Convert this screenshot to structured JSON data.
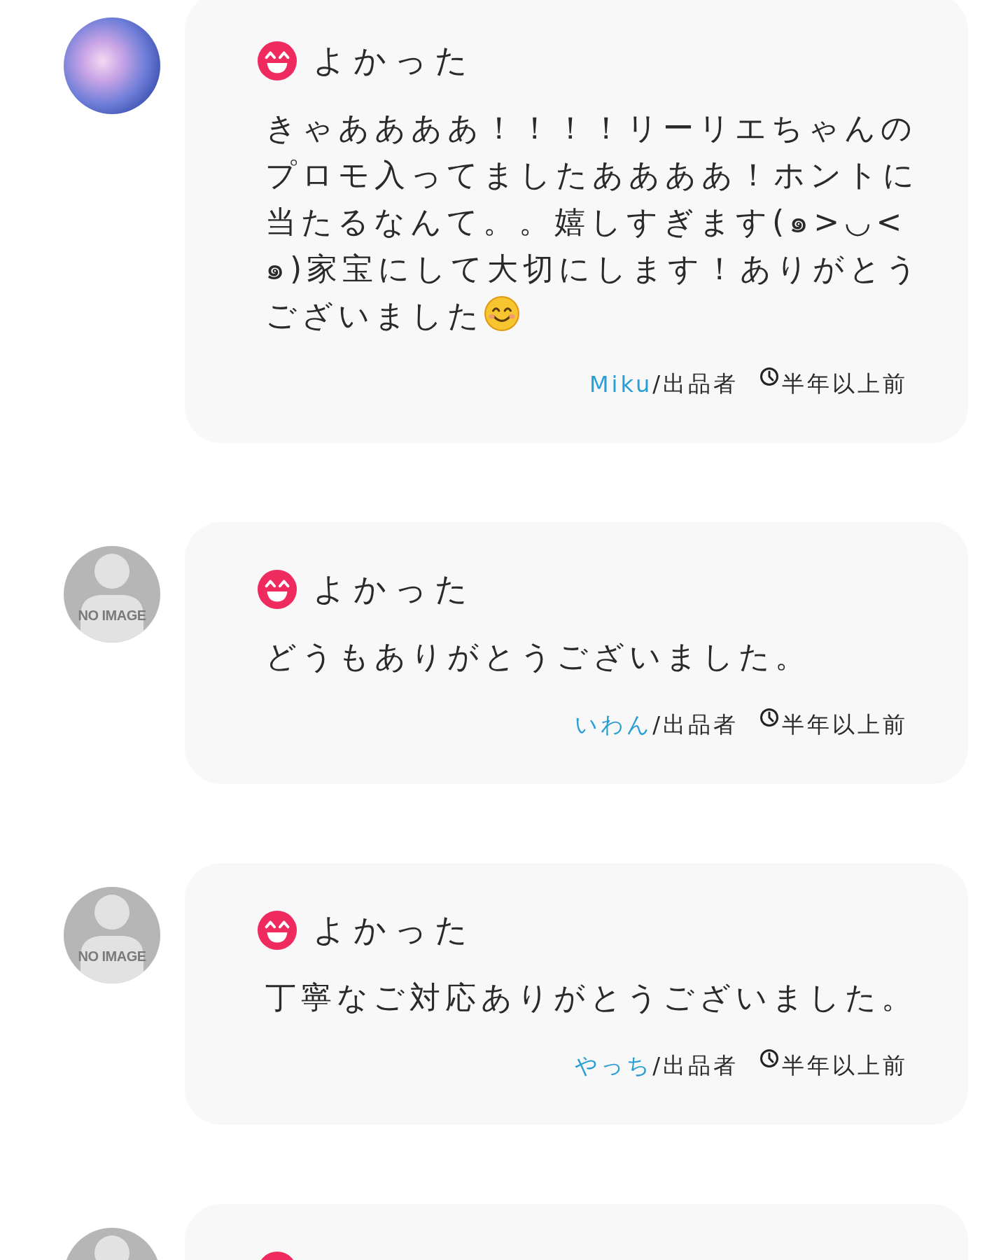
{
  "reviews": [
    {
      "avatar": {
        "kind": "photo"
      },
      "rating": {
        "kind": "good",
        "label": "よかった"
      },
      "comment": "きゃああああ！！！！リーリエちゃんのプロモ入ってましたああああ！ホントに当たるなんて。。嬉しすぎます(๑>◡<๑)家宝にして大切にします！ありがとうございました",
      "ends_with_emoji": true,
      "author": "Miku",
      "role": "/出品者",
      "time": "半年以上前"
    },
    {
      "avatar": {
        "kind": "placeholder",
        "label": "NO IMAGE"
      },
      "rating": {
        "kind": "good",
        "label": "よかった"
      },
      "comment": "どうもありがとうございました。",
      "ends_with_emoji": false,
      "author": "いわん",
      "role": "/出品者",
      "time": "半年以上前"
    },
    {
      "avatar": {
        "kind": "placeholder",
        "label": "NO IMAGE"
      },
      "rating": {
        "kind": "good",
        "label": "よかった"
      },
      "comment": "丁寧なご対応ありがとうございました。",
      "ends_with_emoji": false,
      "author": "やっち",
      "role": "/出品者",
      "time": "半年以上前"
    },
    {
      "avatar": {
        "kind": "placeholder"
      },
      "rating": {
        "kind": "good"
      }
    }
  ]
}
